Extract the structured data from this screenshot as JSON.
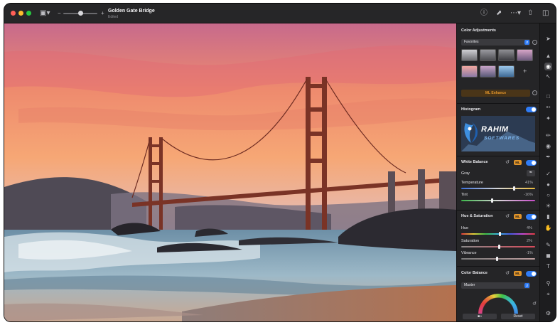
{
  "window": {
    "title": "Golden Gate Bridge",
    "subtitle": "Edited"
  },
  "titlebar_icons": [
    "sidebar-icon",
    "info-icon",
    "share-icon",
    "more-icon",
    "export-icon",
    "panel-icon"
  ],
  "panel": {
    "header": "Color Adjustments",
    "preset_select": "Favorites",
    "ml_enhance_label": "ML Enhance",
    "histogram": {
      "label": "Histogram",
      "watermark_top": "RAHIM",
      "watermark_bottom": "SOFTWARES"
    },
    "white_balance": {
      "label": "White Balance",
      "ml_badge": "ML",
      "mode_label": "Gray",
      "temperature": {
        "label": "Temperature",
        "value_text": "41%",
        "level": 0.72
      },
      "tint": {
        "label": "Tint",
        "value_text": "-16%",
        "level": 0.42
      }
    },
    "hue_saturation": {
      "label": "Hue & Saturation",
      "ml_badge": "ML",
      "hue": {
        "label": "Hue",
        "value_text": "4%",
        "level": 0.52
      },
      "saturation": {
        "label": "Saturation",
        "value_text": "2%",
        "level": 0.51
      },
      "vibrance": {
        "label": "Vibrance",
        "value_text": "-1%",
        "level": 0.49
      }
    },
    "color_balance": {
      "label": "Color Balance",
      "ml_badge": "ML",
      "select": "Master"
    },
    "footer": {
      "toggle_label": "■◑",
      "reset_label": "Reset"
    }
  },
  "colors": {
    "accent": "#2f7cf6",
    "ml_badge": "#e2952a",
    "panel_bg": "#252527"
  }
}
